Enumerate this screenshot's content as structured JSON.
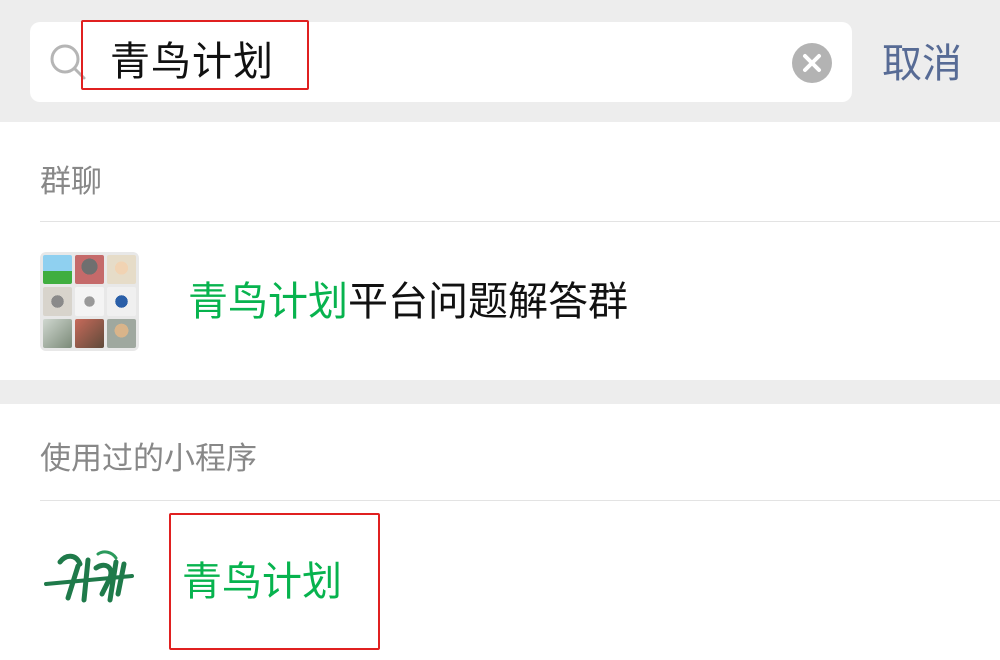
{
  "search": {
    "query": "青鸟计划",
    "cancel_label": "取消"
  },
  "group_chats": {
    "header": "群聊",
    "items": [
      {
        "title_highlight": "青鸟计划",
        "title_rest": "平台问题解答群"
      }
    ]
  },
  "mini_programs": {
    "header": "使用过的小程序",
    "items": [
      {
        "title": "青鸟计划"
      }
    ]
  },
  "colors": {
    "highlight": "#07b34e",
    "link": "#576b95",
    "annotation_box": "#e02020"
  }
}
